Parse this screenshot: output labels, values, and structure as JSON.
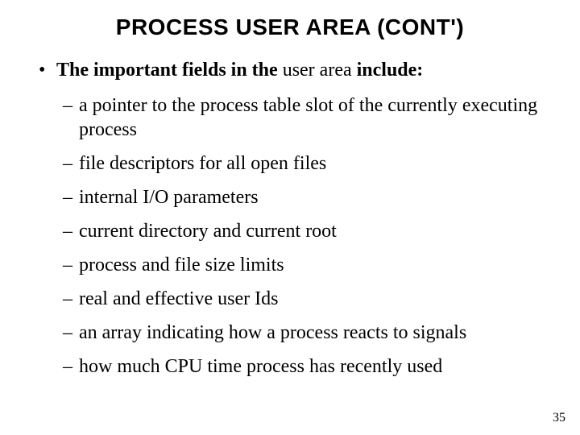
{
  "title": "PROCESS USER AREA (CONT')",
  "lead": {
    "prefix_bold": "The important fields in the",
    "mid_plain": " user area ",
    "suffix_bold": "include:"
  },
  "items": [
    "a pointer to the process table slot of the currently executing process",
    "file descriptors for all open files",
    "internal I/O parameters",
    "current directory and current root",
    "process and file size limits",
    "real and effective user Ids",
    "an array indicating how a process reacts to signals",
    "how much CPU time process has recently used"
  ],
  "page_number": "35"
}
